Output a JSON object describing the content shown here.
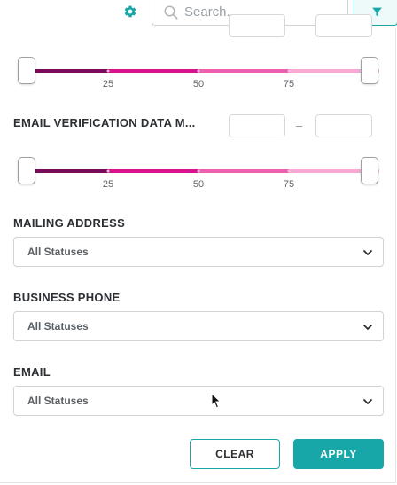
{
  "colors": {
    "accent": "#17a7a8",
    "slider_dark": "#7a0b5c",
    "slider_mid": "#d9138e",
    "slider_light": "#ee5fb0",
    "slider_lightest": "#f7a9d4"
  },
  "toolbar": {
    "settings_icon": "gear-icon",
    "search_placeholder": "Search...",
    "search_value": "",
    "filter_icon": "funnel-icon"
  },
  "filters": {
    "first_range": {
      "min_value": "",
      "max_value": "",
      "ticks": [
        "25",
        "50",
        "75"
      ],
      "selected_range": [
        0,
        100
      ]
    },
    "email_verification": {
      "label": "EMAIL VERIFICATION DATA M...",
      "min_value": "",
      "max_value": "",
      "separator": "–",
      "ticks": [
        "25",
        "50",
        "75"
      ],
      "selected_range": [
        0,
        100
      ]
    },
    "mailing_address": {
      "label": "MAILING ADDRESS",
      "selected": "All Statuses"
    },
    "business_phone": {
      "label": "BUSINESS PHONE",
      "selected": "All Statuses"
    },
    "email": {
      "label": "EMAIL",
      "selected": "All Statuses"
    }
  },
  "actions": {
    "clear_label": "CLEAR",
    "apply_label": "APPLY"
  }
}
